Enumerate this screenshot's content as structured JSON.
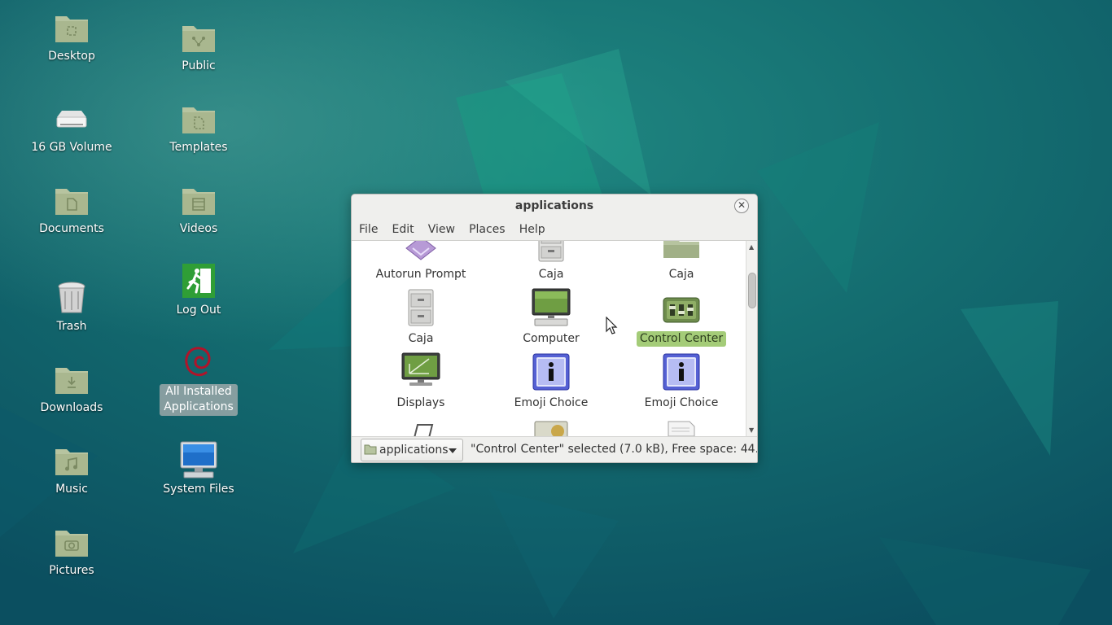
{
  "desktop": {
    "icons": [
      {
        "label": "Desktop",
        "icon": "folder-desktop-icon"
      },
      {
        "label": "16 GB Volume",
        "icon": "drive-icon"
      },
      {
        "label": "Documents",
        "icon": "folder-documents-icon"
      },
      {
        "label": "Trash",
        "icon": "trash-icon"
      },
      {
        "label": "Downloads",
        "icon": "folder-downloads-icon"
      },
      {
        "label": "Music",
        "icon": "folder-music-icon"
      },
      {
        "label": "Pictures",
        "icon": "folder-pictures-icon"
      },
      {
        "label": "Public",
        "icon": "folder-public-icon"
      },
      {
        "label": "Templates",
        "icon": "folder-templates-icon"
      },
      {
        "label": "Videos",
        "icon": "folder-videos-icon"
      },
      {
        "label": "Log Out",
        "icon": "logout-icon"
      },
      {
        "label": "All Installed Applications",
        "line1": "All Installed",
        "line2": "Applications",
        "icon": "debian-swirl-icon",
        "selected": true
      },
      {
        "label": "System Files",
        "icon": "computer-monitor-icon"
      }
    ]
  },
  "window": {
    "title": "applications",
    "close_icon": "close-icon",
    "menu": [
      "File",
      "Edit",
      "View",
      "Places",
      "Help"
    ],
    "files": [
      {
        "label": "Autorun Prompt",
        "icon": "autorun-icon"
      },
      {
        "label": "Caja",
        "icon": "file-cabinet-icon"
      },
      {
        "label": "Caja",
        "icon": "folder-icon"
      },
      {
        "label": "Caja",
        "icon": "file-cabinet-icon"
      },
      {
        "label": "Computer",
        "icon": "computer-icon"
      },
      {
        "label": "Control Center",
        "icon": "control-center-icon",
        "selected": true
      },
      {
        "label": "Displays",
        "icon": "displays-icon"
      },
      {
        "label": "Emoji Choice",
        "icon": "info-icon"
      },
      {
        "label": "Emoji Choice",
        "icon": "info-icon"
      }
    ],
    "location": "applications",
    "status": "\"Control Center\" selected (7.0 kB), Free space: 44…"
  },
  "colors": {
    "wallpaper_base": "#0f5a66",
    "folder_green": "#a9b78f",
    "selection_green": "#a4cc78"
  }
}
